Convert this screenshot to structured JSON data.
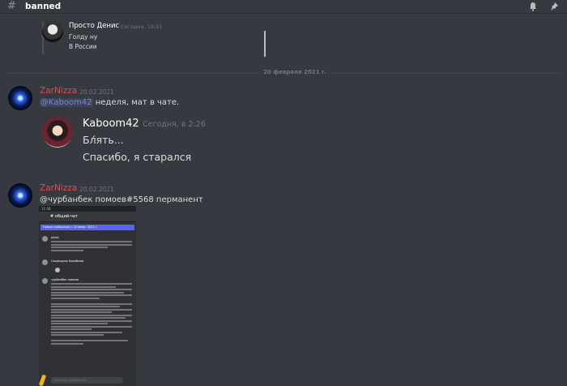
{
  "channel": {
    "name": "banned"
  },
  "icons": {
    "hash": "hash-icon",
    "bell": "bell-icon",
    "pin": "pin-icon"
  },
  "prev_message": {
    "author": "Просто Денис",
    "time": "Сегодня, 19:31",
    "lines": [
      "Голду ну",
      "В России"
    ]
  },
  "date_divider": "20 февраля 2021 г.",
  "messages": [
    {
      "author": "ZarNizza",
      "date": "20.02.2021",
      "mention": "@Kaboom42",
      "text": " неделя, мат в чате.",
      "embed": {
        "author": "Kaboom42",
        "time": "Сегодня, в 2:26",
        "lines": [
          "Бл́ять...",
          "Спасибо, я старался"
        ]
      }
    },
    {
      "author": "ZarNizza",
      "date": "20.02.2021",
      "text": "@чурбанбек помоев#5568 перманент",
      "attachment": {
        "status_time": "11:58",
        "channel": "общий-чат",
        "banner": "Новые сообщения с 20 февр. 2021 г.",
        "users": [
          "pilodr",
          "Скорпшрак Бореймов",
          "чурбанбек помоев"
        ],
        "input_placeholder": "Написать #общий-чат"
      }
    }
  ],
  "colors": {
    "author": "#e24b4b",
    "mention": "#7289da",
    "background": "#36393f"
  }
}
